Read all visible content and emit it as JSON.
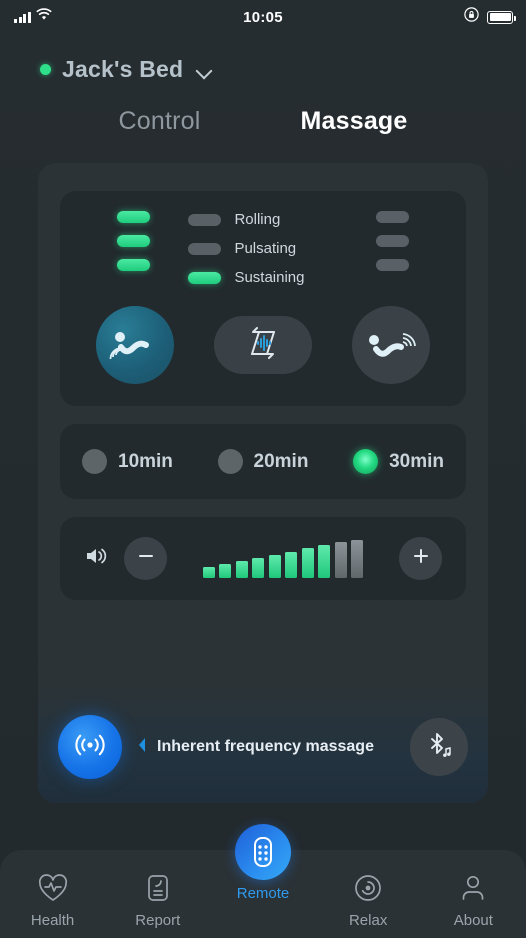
{
  "status_bar": {
    "signal_icon": "cellular-bars-icon",
    "wifi_icon": "wifi-icon",
    "time": "10:05",
    "lock_icon": "rotation-lock-icon",
    "battery_icon": "battery-full-icon"
  },
  "header": {
    "status_dot": "online-dot",
    "device_name": "Jack's Bed",
    "chevron_icon": "chevron-down-icon"
  },
  "tabs": [
    {
      "label": "Control",
      "active": false
    },
    {
      "label": "Massage",
      "active": true
    }
  ],
  "modes": {
    "indicators": {
      "left_column": [
        true,
        true,
        true
      ],
      "middle_column": [
        {
          "label": "Rolling",
          "on": false
        },
        {
          "label": "Pulsating",
          "on": false
        },
        {
          "label": "Sustaining",
          "on": true
        }
      ],
      "right_column": [
        false,
        false,
        false
      ]
    },
    "buttons": [
      {
        "name": "back-massage-button",
        "icon": "person-back-vibration-icon",
        "active": true
      },
      {
        "name": "sync-wave-button",
        "icon": "sync-waveform-icon",
        "active": false
      },
      {
        "name": "leg-massage-button",
        "icon": "person-leg-wave-icon",
        "active": false
      }
    ]
  },
  "timer": {
    "options": [
      {
        "label": "10min",
        "selected": false
      },
      {
        "label": "20min",
        "selected": false
      },
      {
        "label": "30min",
        "selected": true
      }
    ]
  },
  "intensity": {
    "speaker_icon": "volume-icon",
    "minus_icon": "minus-icon",
    "plus_icon": "plus-icon",
    "level": 8,
    "max_level": 10
  },
  "frequency": {
    "radio_icon": "radio-waves-icon",
    "prev_icon": "chevron-left-icon",
    "label": "Inherent frequency massage",
    "bluetooth_icon": "bluetooth-music-icon"
  },
  "bottom_nav": [
    {
      "label": "Health",
      "icon": "heart-pulse-icon",
      "active": false
    },
    {
      "label": "Report",
      "icon": "report-document-icon",
      "active": false
    },
    {
      "label": "Remote",
      "icon": "remote-control-icon",
      "active": true
    },
    {
      "label": "Relax",
      "icon": "relax-target-icon",
      "active": false
    },
    {
      "label": "About",
      "icon": "person-icon",
      "active": false
    }
  ],
  "colors": {
    "accent_green": "#2fe08a",
    "accent_blue": "#2e9bf0",
    "background": "#262d31",
    "card": "#222a2e"
  }
}
